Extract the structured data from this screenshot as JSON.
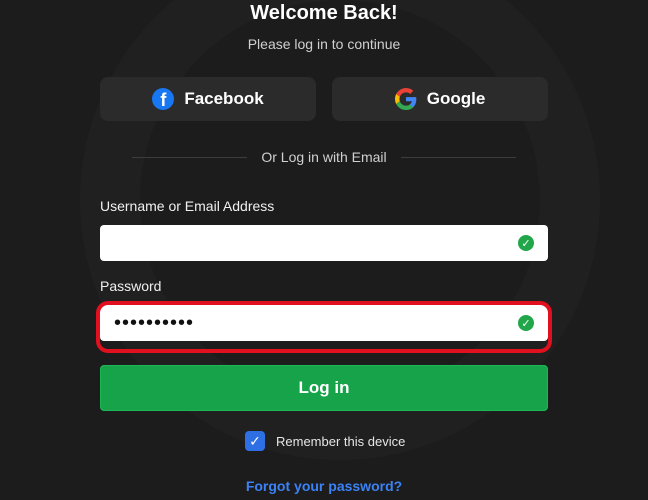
{
  "header": {
    "title": "Welcome Back!",
    "subtitle": "Please log in to continue"
  },
  "social": {
    "facebook_label": "Facebook",
    "facebook_icon": "facebook-icon",
    "google_label": "Google",
    "google_icon": "google-icon"
  },
  "divider_text": "Or Log in with Email",
  "form": {
    "username_label": "Username or Email Address",
    "username_value": "",
    "password_label": "Password",
    "password_value": "••••••••••",
    "valid_icon": "check-circle-icon"
  },
  "login_label": "Log in",
  "remember": {
    "label": "Remember this device",
    "checked": true
  },
  "forgot_label": "Forgot your password?",
  "colors": {
    "accent_green": "#16a34a",
    "link_blue": "#3b82f6",
    "highlight_red": "#e0101e",
    "facebook_blue": "#1877f2"
  }
}
